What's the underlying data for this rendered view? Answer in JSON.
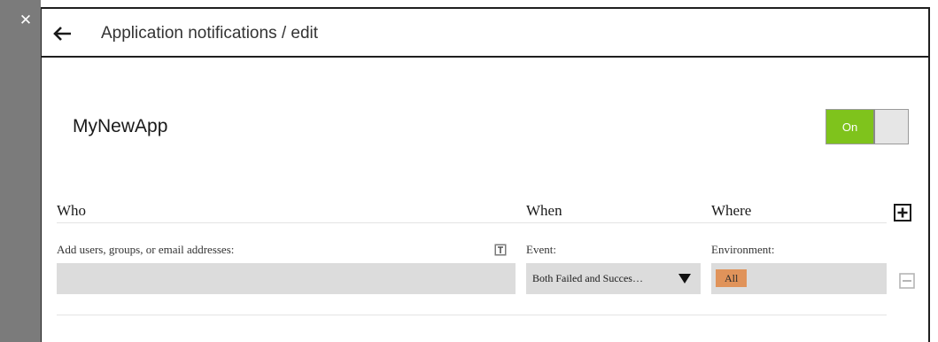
{
  "sidebar": {
    "close_icon": "close-icon"
  },
  "header": {
    "title": "Application notifications / edit",
    "back_icon": "arrow-left-icon"
  },
  "app": {
    "name": "MyNewApp"
  },
  "toggle": {
    "label": "On",
    "state": "on",
    "color": "#7fc31c"
  },
  "columns": {
    "who": "Who",
    "when": "When",
    "where": "Where"
  },
  "rule": {
    "who_label": "Add users, groups, or email addresses:",
    "who_value": "",
    "event_label": "Event:",
    "event_value": "Both Failed and Succes…",
    "environment_label": "Environment:",
    "environment_chip": "All",
    "environment_chip_color": "#e0935a"
  },
  "icons": {
    "add": "plus-box-icon",
    "remove": "minus-box-icon",
    "text_format": "text-format-icon",
    "dropdown": "caret-down-icon"
  }
}
